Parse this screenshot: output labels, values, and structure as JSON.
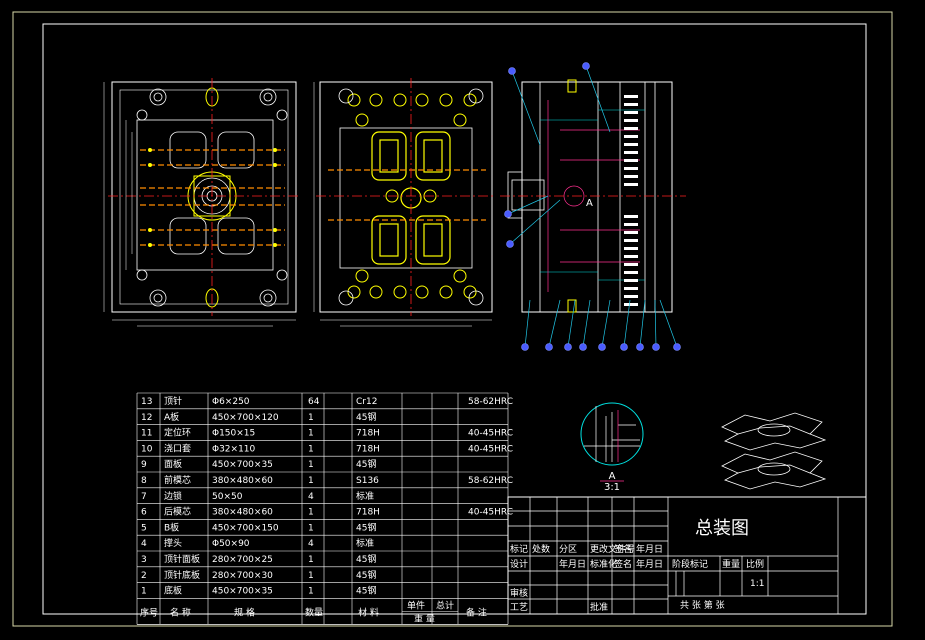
{
  "title_block": {
    "drawing_title": "总装图",
    "scale": "1:1",
    "sheet_text": "共  张  第  张",
    "labels": {
      "biaoji": "标记",
      "chushu": "处数",
      "fenqu": "分区",
      "gengwen": "更改文件号",
      "qianming": "签名",
      "nianyueri": "年月日",
      "sheji": "设计",
      "nianyueri2": "年月日",
      "biaozhunhua": "标准化",
      "qianming2": "签名",
      "nianyueri3": "年月日",
      "jieduan": "阶段标记",
      "zhongliang": "重量",
      "bili": "比例",
      "shenhe": "审核",
      "gongyi": "工艺",
      "pizhun": "批准"
    }
  },
  "detail_view": {
    "label": "A",
    "scale": "3:1"
  },
  "section_marker": "A",
  "bom": {
    "headers": {
      "no": "序号",
      "name": "名  称",
      "spec": "规    格",
      "qty": "数量",
      "material": "材    料",
      "single": "单件",
      "total": "总计",
      "weight": "重  量",
      "remark": "备  注"
    },
    "rows": [
      {
        "no": "13",
        "name": "顶针",
        "spec": "Φ6×250",
        "qty": "64",
        "material": "Cr12",
        "remark": "58-62HRC"
      },
      {
        "no": "12",
        "name": "A板",
        "spec": "450×700×120",
        "qty": "1",
        "material": "45钢",
        "remark": ""
      },
      {
        "no": "11",
        "name": "定位环",
        "spec": "Φ150×15",
        "qty": "1",
        "material": "718H",
        "remark": "40-45HRC"
      },
      {
        "no": "10",
        "name": "浇口套",
        "spec": "Φ32×110",
        "qty": "1",
        "material": "718H",
        "remark": "40-45HRC"
      },
      {
        "no": "9",
        "name": "面板",
        "spec": "450×700×35",
        "qty": "1",
        "material": "45钢",
        "remark": ""
      },
      {
        "no": "8",
        "name": "前模芯",
        "spec": "380×480×60",
        "qty": "1",
        "material": "S136",
        "remark": "58-62HRC"
      },
      {
        "no": "7",
        "name": "边锁",
        "spec": "50×50",
        "qty": "4",
        "material": "标准",
        "remark": ""
      },
      {
        "no": "6",
        "name": "后模芯",
        "spec": "380×480×60",
        "qty": "1",
        "material": "718H",
        "remark": "40-45HRC"
      },
      {
        "no": "5",
        "name": "B板",
        "spec": "450×700×150",
        "qty": "1",
        "material": "45钢",
        "remark": ""
      },
      {
        "no": "4",
        "name": "撑头",
        "spec": "Φ50×90",
        "qty": "4",
        "material": "标准",
        "remark": ""
      },
      {
        "no": "3",
        "name": "顶针面板",
        "spec": "280×700×25",
        "qty": "1",
        "material": "45钢",
        "remark": ""
      },
      {
        "no": "2",
        "name": "顶针底板",
        "spec": "280×700×30",
        "qty": "1",
        "material": "45钢",
        "remark": ""
      },
      {
        "no": "1",
        "name": "底板",
        "spec": "450×700×35",
        "qty": "1",
        "material": "45钢",
        "remark": ""
      }
    ]
  },
  "colors": {
    "background": "#000000",
    "frame": "#ffffff",
    "outer_frame": "#d8d8a8",
    "parts_yellow": "#ffff00",
    "centerline_red": "#ff2020",
    "balloon_blue": "#4a5cff",
    "leader_cyan": "#20c8e8",
    "section_magenta": "#ff3090",
    "section_cyan": "#00e0e0",
    "orange": "#ff8c00"
  }
}
